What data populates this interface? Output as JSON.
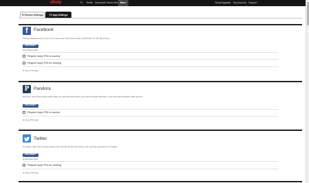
{
  "nav": {
    "brand": "xfinity",
    "items": [
      "TV",
      "Email",
      "Voicemail",
      "Home Security",
      "More"
    ],
    "right_items": [
      "Shop/Upgrade",
      "My Account",
      "Support"
    ],
    "active_item": "More"
  },
  "tabs": [
    "TV Device Settings",
    "TV App Settings"
  ],
  "active_tab": "TV App Settings",
  "apps": [
    {
      "name": "Facebook",
      "icon": "facebook-icon",
      "description": "Access Facebook from your TV to view your news feed, posts, and photos on the big screen.",
      "button_label": "DISCONNECT",
      "status": "Connected User",
      "options": [
        "Require Apps PIN to access",
        "Require Apps PIN for sharing"
      ],
      "help_link": "Apps PIN Help"
    },
    {
      "name": "Pandora",
      "icon": "pandora-icon",
      "description": "Discover new music along with music you already know when you listen through Pandora, a free and personalized radio service.",
      "button_label": "DISCONNECT",
      "status": "",
      "options": [
        "Require Apps PIN to access"
      ],
      "help_link": "Apps PIN Help"
    },
    {
      "name": "Twitter",
      "icon": "twitter-icon",
      "description": "It's easier than ever to tweet about your favorite shows and share your viewing experience on Twitter.",
      "button_label": "DISCONNECT",
      "status": "Connected User",
      "options": [
        "Require Apps PIN for sharing"
      ],
      "help_link": "Apps PIN Help"
    }
  ],
  "colors": {
    "nav_bg": "#151515",
    "brand": "#d3343a",
    "button": "#3a5a86",
    "link": "#3a6ea5",
    "facebook": "#3b5998",
    "pandora": "#1f3b5a",
    "twitter": "#3a8ed4"
  }
}
